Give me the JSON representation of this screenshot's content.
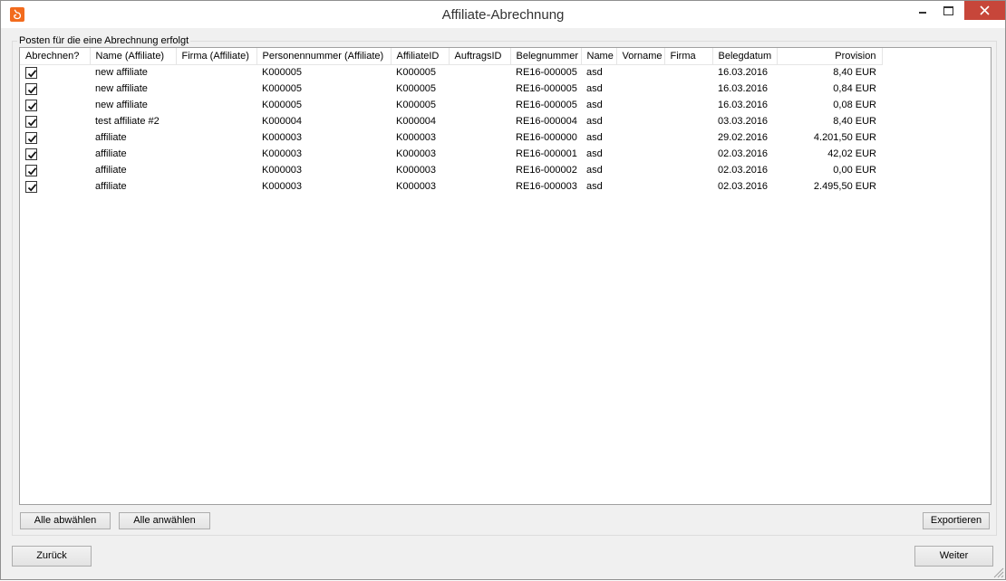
{
  "window": {
    "title": "Affiliate-Abrechnung"
  },
  "group": {
    "label": "Posten für die eine Abrechnung erfolgt"
  },
  "table": {
    "columns": [
      "Abrechnen?",
      "Name (Affiliate)",
      "Firma (Affiliate)",
      "Personennummer (Affiliate)",
      "AffiliateID",
      "AuftragsID",
      "Belegnummer",
      "Name",
      "Vorname",
      "Firma",
      "Belegdatum",
      "Provision"
    ],
    "rows": [
      {
        "checked": true,
        "name": "new affiliate",
        "firma": "",
        "personennummer": "K000005",
        "affiliate_id": "K000005",
        "auftrags_id": "",
        "belegnummer": "RE16-000005",
        "name2": "asd",
        "vorname": "",
        "firma2": "",
        "belegdatum": "16.03.2016",
        "provision": "8,40 EUR"
      },
      {
        "checked": true,
        "name": "new affiliate",
        "firma": "",
        "personennummer": "K000005",
        "affiliate_id": "K000005",
        "auftrags_id": "",
        "belegnummer": "RE16-000005",
        "name2": "asd",
        "vorname": "",
        "firma2": "",
        "belegdatum": "16.03.2016",
        "provision": "0,84 EUR"
      },
      {
        "checked": true,
        "name": "new affiliate",
        "firma": "",
        "personennummer": "K000005",
        "affiliate_id": "K000005",
        "auftrags_id": "",
        "belegnummer": "RE16-000005",
        "name2": "asd",
        "vorname": "",
        "firma2": "",
        "belegdatum": "16.03.2016",
        "provision": "0,08 EUR"
      },
      {
        "checked": true,
        "name": "test affiliate #2",
        "firma": "",
        "personennummer": "K000004",
        "affiliate_id": "K000004",
        "auftrags_id": "",
        "belegnummer": "RE16-000004",
        "name2": "asd",
        "vorname": "",
        "firma2": "",
        "belegdatum": "03.03.2016",
        "provision": "8,40 EUR"
      },
      {
        "checked": true,
        "name": "affiliate",
        "firma": "",
        "personennummer": "K000003",
        "affiliate_id": "K000003",
        "auftrags_id": "",
        "belegnummer": "RE16-000000",
        "name2": "asd",
        "vorname": "",
        "firma2": "",
        "belegdatum": "29.02.2016",
        "provision": "4.201,50 EUR"
      },
      {
        "checked": true,
        "name": "affiliate",
        "firma": "",
        "personennummer": "K000003",
        "affiliate_id": "K000003",
        "auftrags_id": "",
        "belegnummer": "RE16-000001",
        "name2": "asd",
        "vorname": "",
        "firma2": "",
        "belegdatum": "02.03.2016",
        "provision": "42,02 EUR"
      },
      {
        "checked": true,
        "name": "affiliate",
        "firma": "",
        "personennummer": "K000003",
        "affiliate_id": "K000003",
        "auftrags_id": "",
        "belegnummer": "RE16-000002",
        "name2": "asd",
        "vorname": "",
        "firma2": "",
        "belegdatum": "02.03.2016",
        "provision": "0,00 EUR"
      },
      {
        "checked": true,
        "name": "affiliate",
        "firma": "",
        "personennummer": "K000003",
        "affiliate_id": "K000003",
        "auftrags_id": "",
        "belegnummer": "RE16-000003",
        "name2": "asd",
        "vorname": "",
        "firma2": "",
        "belegdatum": "02.03.2016",
        "provision": "2.495,50 EUR"
      }
    ]
  },
  "buttons": {
    "deselect_all": "Alle abwählen",
    "select_all": "Alle anwählen",
    "export": "Exportieren",
    "back": "Zurück",
    "next": "Weiter"
  }
}
